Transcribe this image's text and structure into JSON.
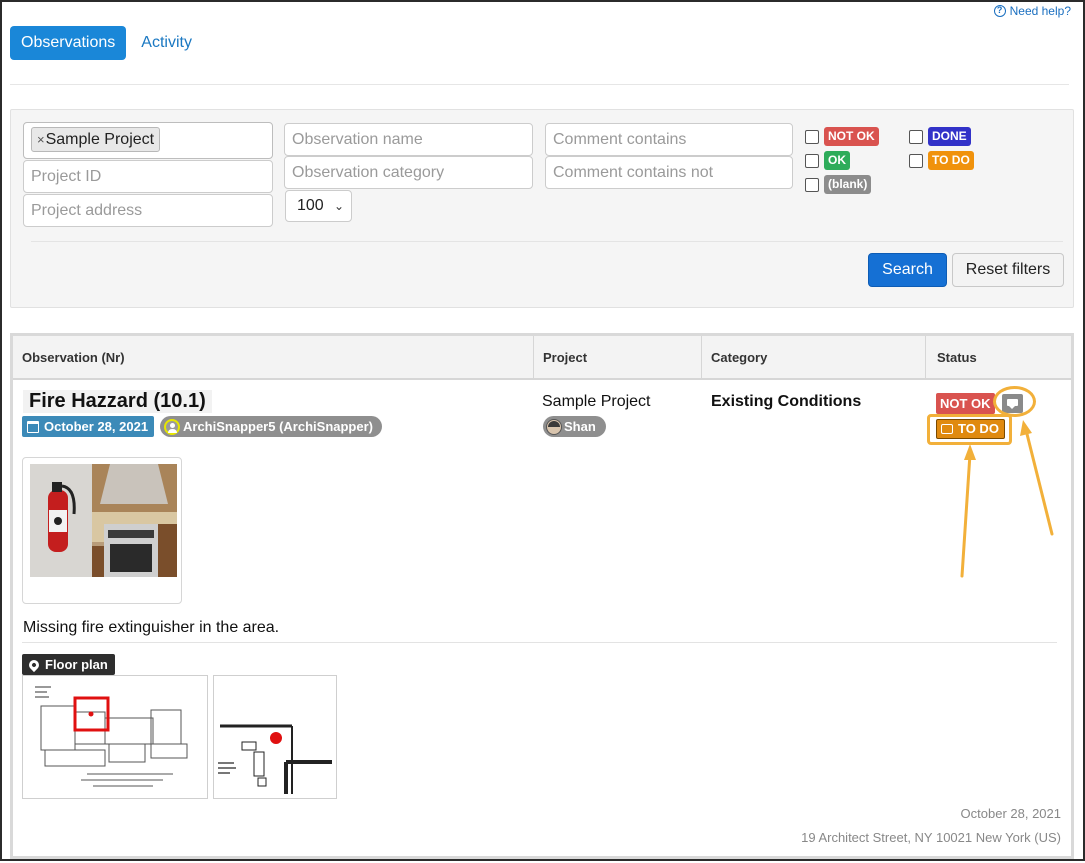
{
  "help": {
    "label": "Need help?"
  },
  "tabs": [
    {
      "label": "Observations",
      "active": true
    },
    {
      "label": "Activity",
      "active": false
    }
  ],
  "filters": {
    "project_chip": "Sample Project",
    "project_id_placeholder": "Project ID",
    "project_address_placeholder": "Project address",
    "observation_name_placeholder": "Observation name",
    "observation_category_placeholder": "Observation category",
    "page_size": "100",
    "comment_contains_placeholder": "Comment contains",
    "comment_contains_not_placeholder": "Comment contains not",
    "status_options": [
      {
        "label": "NOT OK",
        "color": "#d9534f",
        "checked": false
      },
      {
        "label": "OK",
        "color": "#2eac5a",
        "checked": false
      },
      {
        "label": "(blank)",
        "color": "#8c8c8c",
        "checked": false
      },
      {
        "label": "DONE",
        "color": "#3232c8",
        "checked": false
      },
      {
        "label": "TO DO",
        "color": "#f0920c",
        "checked": false
      }
    ],
    "search_label": "Search",
    "reset_label": "Reset filters"
  },
  "table": {
    "columns": [
      "Observation (Nr)",
      "Project",
      "Category",
      "Status"
    ],
    "row": {
      "title": "Fire Hazzard (10.1)",
      "date": "October 28, 2021",
      "author": "ArchiSnapper5 (ArchiSnapper)",
      "description": "Missing fire extinguisher in the area.",
      "floor_plan_label": "Floor plan",
      "project": "Sample Project",
      "project_user": "Shan",
      "category": "Existing Conditions",
      "status_primary": "NOT OK",
      "status_secondary": "TO DO",
      "footer_date": "October 28, 2021",
      "footer_address": "19 Architect Street, NY 10021 New York (US)"
    }
  },
  "colors": {
    "accent": "#1a87d8",
    "highlight": "#f2b03a",
    "not_ok": "#d9534f",
    "todo": "#e08a0f"
  }
}
